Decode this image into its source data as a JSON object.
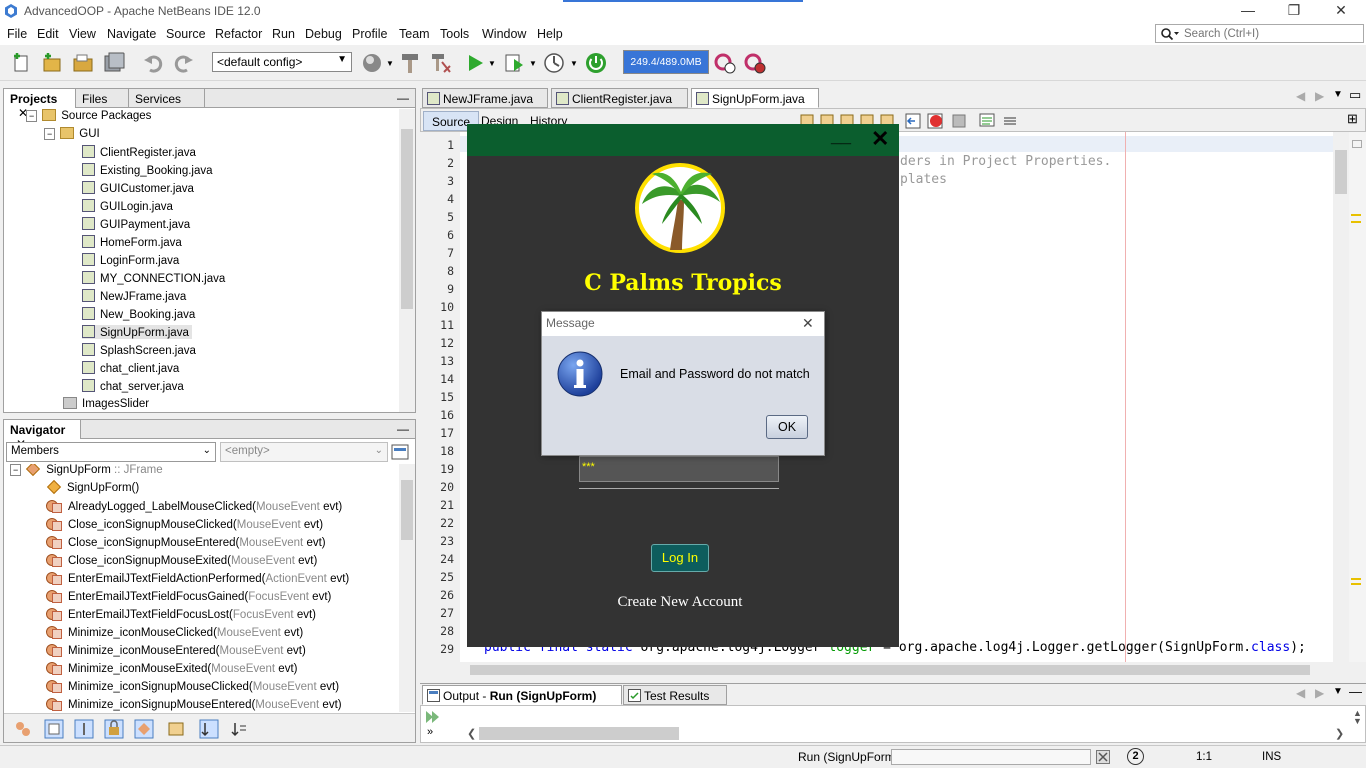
{
  "window": {
    "title": "AdvancedOOP - Apache NetBeans IDE 12.0",
    "minimize": "—",
    "restore": "❐",
    "close": "✕"
  },
  "menu": [
    "File",
    "Edit",
    "View",
    "Navigate",
    "Source",
    "Refactor",
    "Run",
    "Debug",
    "Profile",
    "Team",
    "Tools",
    "Window",
    "Help"
  ],
  "search": {
    "placeholder": "Search (Ctrl+I)"
  },
  "toolbar": {
    "config": "<default config>",
    "memory": "249.4/489.0MB"
  },
  "projects_panel": {
    "tabs": [
      "Projects",
      "Files",
      "Services"
    ],
    "root": "Source Packages",
    "package": "GUI",
    "files": [
      "ClientRegister.java",
      "Existing_Booking.java",
      "GUICustomer.java",
      "GUILogin.java",
      "GUIPayment.java",
      "HomeForm.java",
      "LoginForm.java",
      "MY_CONNECTION.java",
      "NewJFrame.java",
      "New_Booking.java",
      "SignUpForm.java",
      "SplashScreen.java",
      "chat_client.java",
      "chat_server.java"
    ],
    "selected_file": "SignUpForm.java",
    "next_package": "ImagesSlider"
  },
  "navigator": {
    "title": "Navigator",
    "filter": "Members",
    "empty": "<empty>",
    "root_name": "SignUpForm",
    "root_type": " :: JFrame",
    "constructor": "SignUpForm()",
    "members": [
      {
        "name": "AlreadyLogged_LabelMouseClicked(",
        "ptype": "MouseEvent",
        "param": " evt)"
      },
      {
        "name": "Close_iconSignupMouseClicked(",
        "ptype": "MouseEvent",
        "param": " evt)"
      },
      {
        "name": "Close_iconSignupMouseEntered(",
        "ptype": "MouseEvent",
        "param": " evt)"
      },
      {
        "name": "Close_iconSignupMouseExited(",
        "ptype": "MouseEvent",
        "param": " evt)"
      },
      {
        "name": "EnterEmailJTextFieldActionPerformed(",
        "ptype": "ActionEvent",
        "param": " evt)"
      },
      {
        "name": "EnterEmailJTextFieldFocusGained(",
        "ptype": "FocusEvent",
        "param": " evt)"
      },
      {
        "name": "EnterEmailJTextFieldFocusLost(",
        "ptype": "FocusEvent",
        "param": " evt)"
      },
      {
        "name": "Minimize_iconMouseClicked(",
        "ptype": "MouseEvent",
        "param": " evt)"
      },
      {
        "name": "Minimize_iconMouseEntered(",
        "ptype": "MouseEvent",
        "param": " evt)"
      },
      {
        "name": "Minimize_iconMouseExited(",
        "ptype": "MouseEvent",
        "param": " evt)"
      },
      {
        "name": "Minimize_iconSignupMouseClicked(",
        "ptype": "MouseEvent",
        "param": " evt)"
      },
      {
        "name": "Minimize_iconSignupMouseEntered(",
        "ptype": "MouseEvent",
        "param": " evt)"
      }
    ]
  },
  "editor": {
    "tabs": [
      "NewJFrame.java",
      "ClientRegister.java",
      "SignUpForm.java"
    ],
    "active_tab": "SignUpForm.java",
    "subtabs": [
      "Source",
      "Design",
      "History"
    ],
    "line_numbers": [
      "1",
      "2",
      "3",
      "4",
      "5",
      "6",
      "7",
      "8",
      "9",
      "10",
      "11",
      "12",
      "13",
      "14",
      "15",
      "16",
      "17",
      "18",
      "19",
      "20",
      "21",
      "22",
      "23",
      "24",
      "25",
      "26",
      "27",
      "28",
      "29"
    ],
    "code_line2": "ders in Project Properties.",
    "code_line3": "plates",
    "code_line29_kw": "public final static ",
    "code_line29_mid": "org.apache.log4j.Logger ",
    "code_line29_var": "logger",
    "code_line29_rest": " = org.apache.log4j.Logger.getLogger(SignUpForm.",
    "code_line29_cls": "class",
    "code_line29_end": ");"
  },
  "signup_form": {
    "minimize": "__",
    "close": "✕",
    "brand": "C Palms Tropics",
    "password_mask": "***",
    "login_button": "Log In",
    "create_account": "Create New Account"
  },
  "dialog": {
    "title": "Message",
    "close": "✕",
    "message": "Email and Password do not match",
    "ok": "OK"
  },
  "output": {
    "tabs": [
      "Output - ",
      "Run (SignUpForm)",
      "Test Results"
    ]
  },
  "status": {
    "task": "Run (SignUpForm)",
    "notifications": "2",
    "position": "1:1",
    "mode": "INS"
  },
  "colors": {
    "brand": "#ffff00",
    "form_bg": "#333333",
    "form_header": "#0b5e2e",
    "login_btn": "#0d5d5d"
  }
}
